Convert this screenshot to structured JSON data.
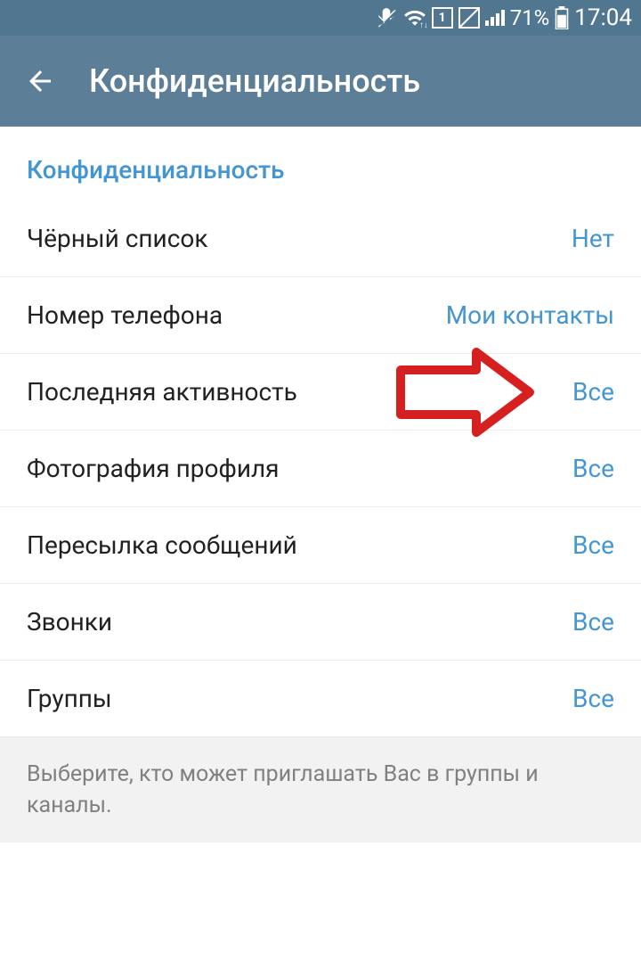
{
  "status_bar": {
    "battery_percent": "71%",
    "time": "17:04"
  },
  "app_bar": {
    "title": "Конфиденциальность"
  },
  "section": {
    "header": "Конфиденциальность",
    "items": [
      {
        "label": "Чёрный список",
        "value": "Нет"
      },
      {
        "label": "Номер телефона",
        "value": "Мои контакты"
      },
      {
        "label": "Последняя активность",
        "value": "Все"
      },
      {
        "label": "Фотография профиля",
        "value": "Все"
      },
      {
        "label": "Пересылка сообщений",
        "value": "Все"
      },
      {
        "label": "Звонки",
        "value": "Все"
      },
      {
        "label": "Группы",
        "value": "Все"
      }
    ]
  },
  "footer": {
    "text": "Выберите, кто может приглашать Вас в группы и каналы."
  }
}
